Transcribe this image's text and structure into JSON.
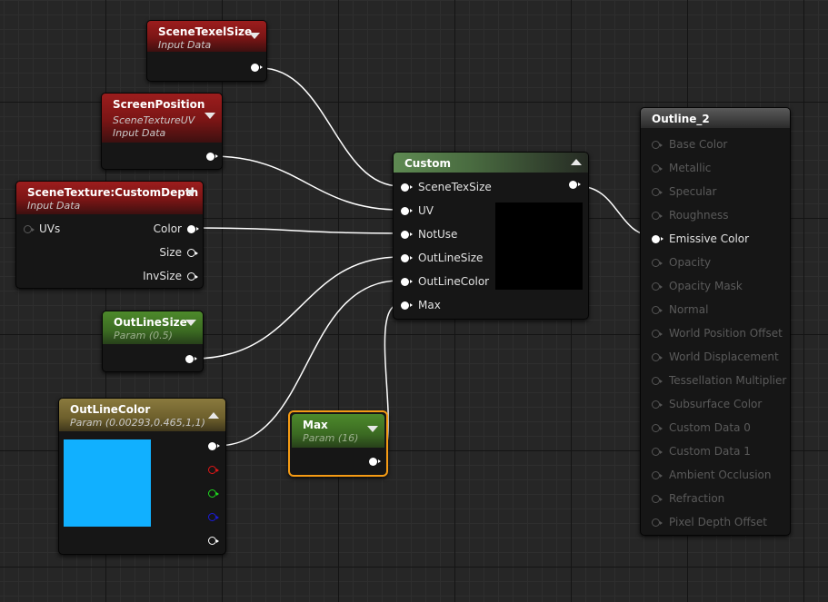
{
  "nodes": {
    "scene_texel_size": {
      "title": "SceneTexelSize",
      "subtitle": "Input Data"
    },
    "screen_position": {
      "title": "ScreenPosition",
      "subtitle_1": "SceneTextureUV",
      "subtitle_2": "Input Data"
    },
    "scene_texture": {
      "title": "SceneTexture:CustomDepth",
      "subtitle": "Input Data",
      "inputs": [
        "UVs"
      ],
      "outputs": [
        "Color",
        "Size",
        "InvSize"
      ]
    },
    "outline_size": {
      "title": "OutLineSize",
      "subtitle": "Param (0.5)"
    },
    "outline_color": {
      "title": "OutLineColor",
      "subtitle": "Param (0.00293,0.465,1,1)",
      "swatch": "#11b0ff"
    },
    "max": {
      "title": "Max",
      "subtitle": "Param (16)"
    },
    "custom": {
      "title": "Custom",
      "inputs": [
        "SceneTexSize",
        "UV",
        "NotUse",
        "OutLineSize",
        "OutLineColor",
        "Max"
      ]
    },
    "outline_2": {
      "title": "Outline_2",
      "inputs": [
        "Base Color",
        "Metallic",
        "Specular",
        "Roughness",
        "Emissive Color",
        "Opacity",
        "Opacity Mask",
        "Normal",
        "World Position Offset",
        "World Displacement",
        "Tessellation Multiplier",
        "Subsurface Color",
        "Custom Data 0",
        "Custom Data 1",
        "Ambient Occlusion",
        "Refraction",
        "Pixel Depth Offset"
      ],
      "active_input": "Emissive Color"
    }
  },
  "colors": {
    "wire": "#ffffff",
    "selection": "#f59b14",
    "param_swatch": "#11b0ff"
  }
}
